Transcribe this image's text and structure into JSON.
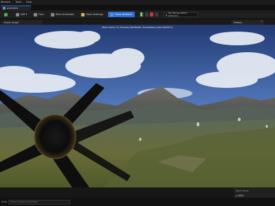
{
  "menu": [
    "Window",
    "Tools",
    "Help"
  ],
  "tab": {
    "label": "overview"
  },
  "toolbar": {
    "buttons": [
      {
        "label": "",
        "icon": "compile-icon"
      },
      {
        "label": "Diff ▾",
        "icon": "diff-icon"
      },
      {
        "label": "Find",
        "icon": "find-icon"
      },
      {
        "label": "Hide Unrelated",
        "icon": "hide-unrelated-icon"
      },
      {
        "label": "Class Settings",
        "icon": "class-settings-icon"
      },
      {
        "label": "Class Defaults",
        "icon": "class-defaults-icon"
      }
    ],
    "debug_select": "No debug object selected"
  },
  "panels": {
    "left": "Event Graph",
    "right": "Details"
  },
  "viewport": {
    "title": "Mech Actor (F) Preview [NetMode: Standalone] (64-bit/DX11)"
  },
  "bottom_right": {
    "line1": "Rock Frame",
    "line2": "▸ AURA"
  },
  "status": {
    "cmd_label": "Cmd",
    "cmd_placeholder": "Enter Console Command"
  },
  "colors": {
    "accent": "#2a6fd6",
    "stop": "#c43b3b",
    "play": "#7bd17b"
  }
}
